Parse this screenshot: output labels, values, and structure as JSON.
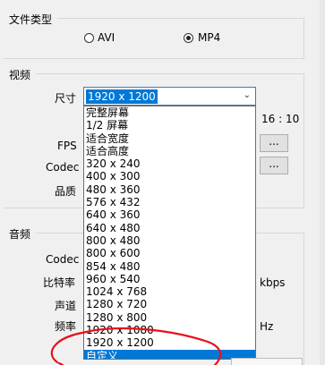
{
  "file_type": {
    "title": "文件类型",
    "options": [
      "AVI",
      "MP4"
    ],
    "selected": "MP4"
  },
  "video": {
    "title": "视频",
    "size_label": "尺寸",
    "size_value": "1920 x 1200",
    "aspect_ratio": "16 : 10",
    "fps_label": "FPS",
    "codec_label": "Codec",
    "quality_label": "品质",
    "browse_button": "..."
  },
  "audio": {
    "title": "音频",
    "codec_label": "Codec",
    "bitrate_label": "比特率",
    "bitrate_unit": "kbps",
    "channel_label": "声道",
    "frequency_label": "频率",
    "frequency_unit": "Hz"
  },
  "size_dropdown": {
    "options": [
      "完整屏幕",
      "1/2 屏幕",
      "适合宽度",
      "适合高度",
      "320 x 240",
      "400 x 300",
      "480 x 360",
      "576 x 432",
      "640 x 360",
      "640 x 480",
      "800 x 480",
      "800 x 600",
      "854 x 480",
      "960 x 540",
      "1024 x 768",
      "1280 x 720",
      "1280 x 800",
      "1920 x 1080",
      "1920 x 1200",
      "自定义"
    ],
    "highlighted": "自定义"
  },
  "colors": {
    "selection": "#0078d7",
    "annotation": "#e8101a"
  }
}
